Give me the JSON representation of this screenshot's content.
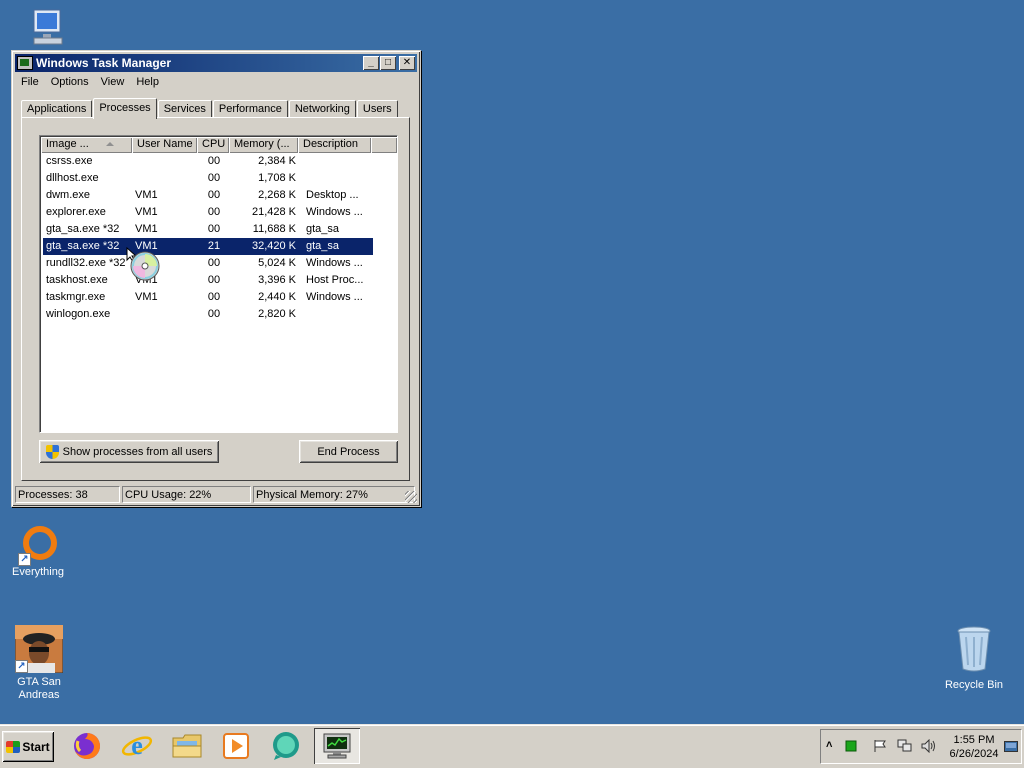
{
  "desktop": {
    "icons": [
      {
        "label": "Everything"
      },
      {
        "label": "GTA San Andreas"
      },
      {
        "label": "Recycle Bin"
      }
    ]
  },
  "window": {
    "title": "Windows Task Manager",
    "menu": [
      "File",
      "Options",
      "View",
      "Help"
    ],
    "tabs": [
      "Applications",
      "Processes",
      "Services",
      "Performance",
      "Networking",
      "Users"
    ],
    "active_tab": "Processes",
    "columns": [
      "Image ...",
      "User Name",
      "CPU",
      "Memory (...",
      "Description"
    ],
    "rows": [
      {
        "name": "csrss.exe",
        "user": "",
        "cpu": "00",
        "mem": "2,384 K",
        "desc": ""
      },
      {
        "name": "dllhost.exe",
        "user": "",
        "cpu": "00",
        "mem": "1,708 K",
        "desc": ""
      },
      {
        "name": "dwm.exe",
        "user": "VM1",
        "cpu": "00",
        "mem": "2,268 K",
        "desc": "Desktop ..."
      },
      {
        "name": "explorer.exe",
        "user": "VM1",
        "cpu": "00",
        "mem": "21,428 K",
        "desc": "Windows ..."
      },
      {
        "name": "gta_sa.exe *32",
        "user": "VM1",
        "cpu": "00",
        "mem": "11,688 K",
        "desc": "gta_sa"
      },
      {
        "name": "gta_sa.exe *32",
        "user": "VM1",
        "cpu": "21",
        "mem": "32,420 K",
        "desc": "gta_sa"
      },
      {
        "name": "rundll32.exe *32",
        "user": "VM1",
        "cpu": "00",
        "mem": "5,024 K",
        "desc": "Windows ..."
      },
      {
        "name": "taskhost.exe",
        "user": "VM1",
        "cpu": "00",
        "mem": "3,396 K",
        "desc": "Host Proc..."
      },
      {
        "name": "taskmgr.exe",
        "user": "VM1",
        "cpu": "00",
        "mem": "2,440 K",
        "desc": "Windows ..."
      },
      {
        "name": "winlogon.exe",
        "user": "",
        "cpu": "00",
        "mem": "2,820 K",
        "desc": ""
      }
    ],
    "selected_row": 5,
    "show_all_button": "Show processes from all users",
    "end_process_button": "End Process",
    "status": {
      "processes": "Processes: 38",
      "cpu": "CPU Usage: 22%",
      "memory": "Physical Memory: 27%"
    }
  },
  "taskbar": {
    "start_label": "Start",
    "clock_time": "1:55 PM",
    "clock_date": "6/26/2024"
  }
}
